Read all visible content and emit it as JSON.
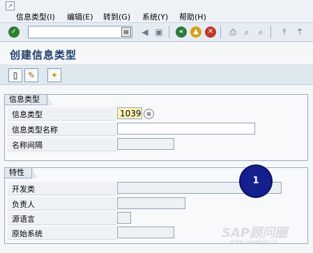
{
  "menubar": {
    "system_icon": "system-icon",
    "items": [
      {
        "label": "信息类型(I)"
      },
      {
        "label": "编辑(E)"
      },
      {
        "label": "转到(G)"
      },
      {
        "label": "系统(Y)"
      },
      {
        "label": "帮助(H)"
      }
    ]
  },
  "toolbar": {
    "command_field_value": "",
    "icons": [
      "enter-icon",
      "history-icon",
      "back-arrow-icon",
      "save-icon",
      "back-icon",
      "exit-icon",
      "cancel-icon",
      "print-icon",
      "find-icon",
      "find-next-icon",
      "first-page-icon",
      "previous-page-icon"
    ]
  },
  "page": {
    "title": "创建信息类型"
  },
  "app_toolbar": {
    "icons": [
      "create-icon",
      "change-icon",
      "wizard-icon"
    ]
  },
  "group_infotype": {
    "title": "信息类型",
    "infotype_label": "信息类型",
    "infotype_value": "1039",
    "infotype_name_label": "信息类型名称",
    "infotype_name_value": "",
    "namespace_label": "名称间隔",
    "namespace_value": ""
  },
  "group_attributes": {
    "title": "特性",
    "dev_class_label": "开发类",
    "dev_class_value": "",
    "responsible_label": "负责人",
    "responsible_value": "",
    "source_lang_label": "源语言",
    "source_lang_value": "",
    "original_system_label": "原始系统",
    "original_system_value": ""
  },
  "annotation": {
    "number": "1",
    "color": "#151f8e"
  },
  "watermark": {
    "text": "SAP顾问圈",
    "url": "www.sapabap.cn"
  },
  "colors": {
    "title": "#1f3c6e",
    "required_field": "#fff6b8"
  }
}
